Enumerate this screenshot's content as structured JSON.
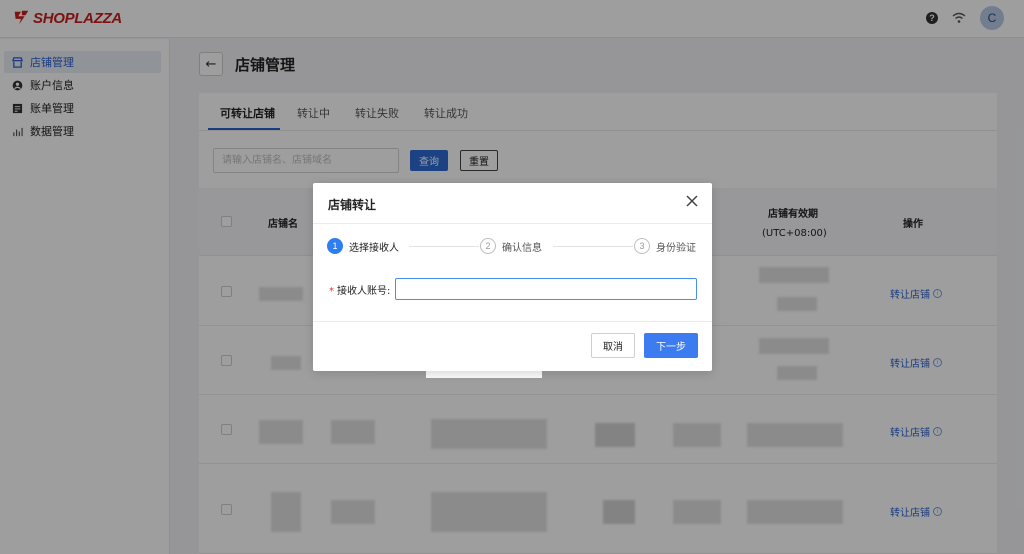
{
  "brand": {
    "name": "SHOPLAZZA",
    "color": "#c81d1d"
  },
  "topbar": {
    "help_icon": "question-circle-icon",
    "wifi_icon": "wifi-icon",
    "avatar_initial": "C"
  },
  "sidebar": {
    "items": [
      {
        "label": "店铺管理",
        "icon": "store-icon",
        "active": true
      },
      {
        "label": "账户信息",
        "icon": "user-circle-icon",
        "active": false
      },
      {
        "label": "账单管理",
        "icon": "bill-icon",
        "active": false
      },
      {
        "label": "数据管理",
        "icon": "bar-chart-icon",
        "active": false
      }
    ]
  },
  "page": {
    "title": "店铺管理",
    "back_icon": "arrow-left-icon"
  },
  "tabs": [
    {
      "label": "可转让店铺",
      "active": true
    },
    {
      "label": "转让中",
      "active": false
    },
    {
      "label": "转让失败",
      "active": false
    },
    {
      "label": "转让成功",
      "active": false
    }
  ],
  "filter": {
    "placeholder": "请输入店铺名、店铺域名",
    "value": "",
    "query_label": "查询",
    "reset_label": "重置"
  },
  "table": {
    "headers": {
      "store_name": "店铺名",
      "validity": "店铺有效期",
      "timezone": "(UTC+08:00)",
      "actions": "操作"
    },
    "rows": [
      {
        "action": "转让店铺"
      },
      {
        "action": "转让店铺"
      },
      {
        "action": "转让店铺"
      },
      {
        "action": "转让店铺"
      }
    ]
  },
  "modal": {
    "title": "店铺转让",
    "close_icon": "close-icon",
    "steps": [
      {
        "num": "1",
        "label": "选择接收人",
        "active": true
      },
      {
        "num": "2",
        "label": "确认信息",
        "active": false
      },
      {
        "num": "3",
        "label": "身份验证",
        "active": false
      }
    ],
    "field": {
      "label": "接收人账号:",
      "required": "*",
      "value": ""
    },
    "cancel_label": "取消",
    "next_label": "下一步"
  },
  "colors": {
    "primary": "#2e6bd6",
    "link": "#2a5fd0",
    "danger": "#e0362c"
  }
}
